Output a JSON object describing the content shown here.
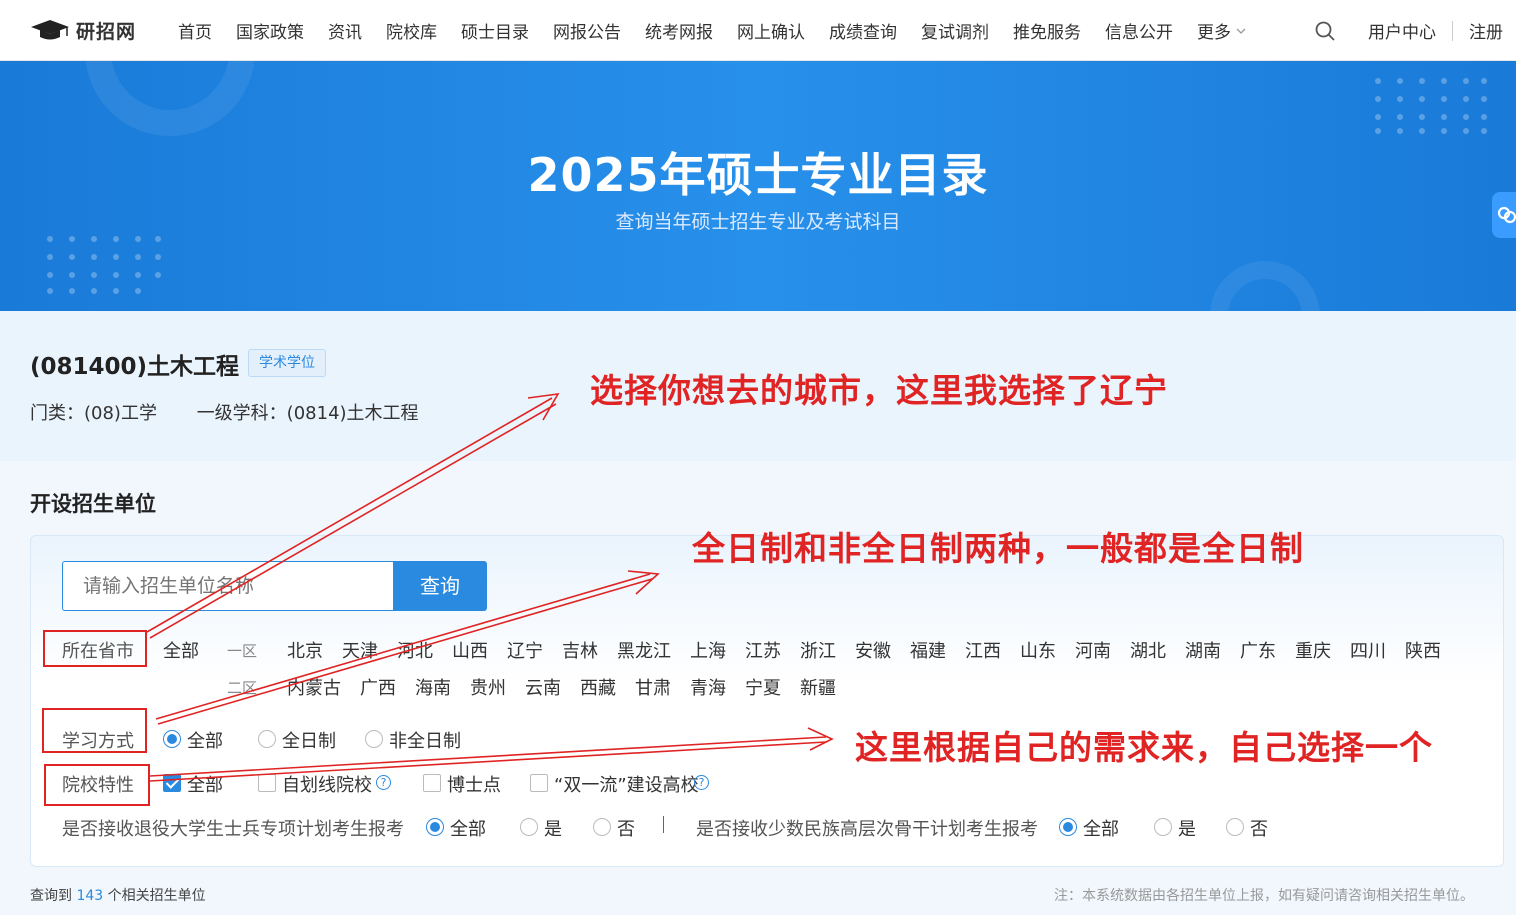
{
  "nav": {
    "logo_text": "研招网",
    "items": [
      "首页",
      "国家政策",
      "资讯",
      "院校库",
      "硕士目录",
      "网报公告",
      "统考网报",
      "网上确认",
      "成绩查询",
      "复试调剂",
      "推免服务",
      "信息公开"
    ],
    "more_label": "更多",
    "user_center": "用户中心",
    "register": "注册"
  },
  "banner": {
    "title": "2025年硕士专业目录",
    "subtitle": "查询当年硕士招生专业及考试科目"
  },
  "major": {
    "title": "(081400)土木工程",
    "tag": "学术学位",
    "category": "门类：(08)工学",
    "discipline": "一级学科：(0814)土木工程"
  },
  "section": {
    "title": "开设招生单位",
    "search_placeholder": "请输入招生单位名称",
    "search_button": "查询"
  },
  "province": {
    "label": "所在省市",
    "all": "全部",
    "zone1": "一区",
    "zone2": "二区",
    "zone1_items": [
      "北京",
      "天津",
      "河北",
      "山西",
      "辽宁",
      "吉林",
      "黑龙江",
      "上海",
      "江苏",
      "浙江",
      "安徽",
      "福建",
      "江西",
      "山东",
      "河南",
      "湖北",
      "湖南",
      "广东",
      "重庆",
      "四川",
      "陕西"
    ],
    "zone2_items": [
      "内蒙古",
      "广西",
      "海南",
      "贵州",
      "云南",
      "西藏",
      "甘肃",
      "青海",
      "宁夏",
      "新疆"
    ]
  },
  "study_mode": {
    "label": "学习方式",
    "options": [
      "全部",
      "全日制",
      "非全日制"
    ],
    "selected": 0
  },
  "school_type": {
    "label": "院校特性",
    "options": [
      "全部",
      "自划线院校",
      "博士点",
      "“双一流”建设高校"
    ]
  },
  "special": {
    "veteran_label": "是否接收退役大学生士兵专项计划考生报考",
    "minority_label": "是否接收少数民族高层次骨干计划考生报考",
    "options": [
      "全部",
      "是",
      "否"
    ],
    "sep": "|"
  },
  "result": {
    "prefix": "查询到",
    "count": "143",
    "suffix": "个相关招生单位",
    "note": "注：本系统数据由各招生单位上报，如有疑问请咨询相关招生单位。"
  },
  "annotations": {
    "city": "选择你想去的城市，这里我选择了辽宁",
    "mode": "全日制和非全日制两种，一般都是全日制",
    "need": "这里根据自己的需求来，自己选择一个"
  },
  "colors": {
    "accent": "#2a8ae0",
    "banner": "#1f84e0",
    "annotation": "#e02424"
  }
}
